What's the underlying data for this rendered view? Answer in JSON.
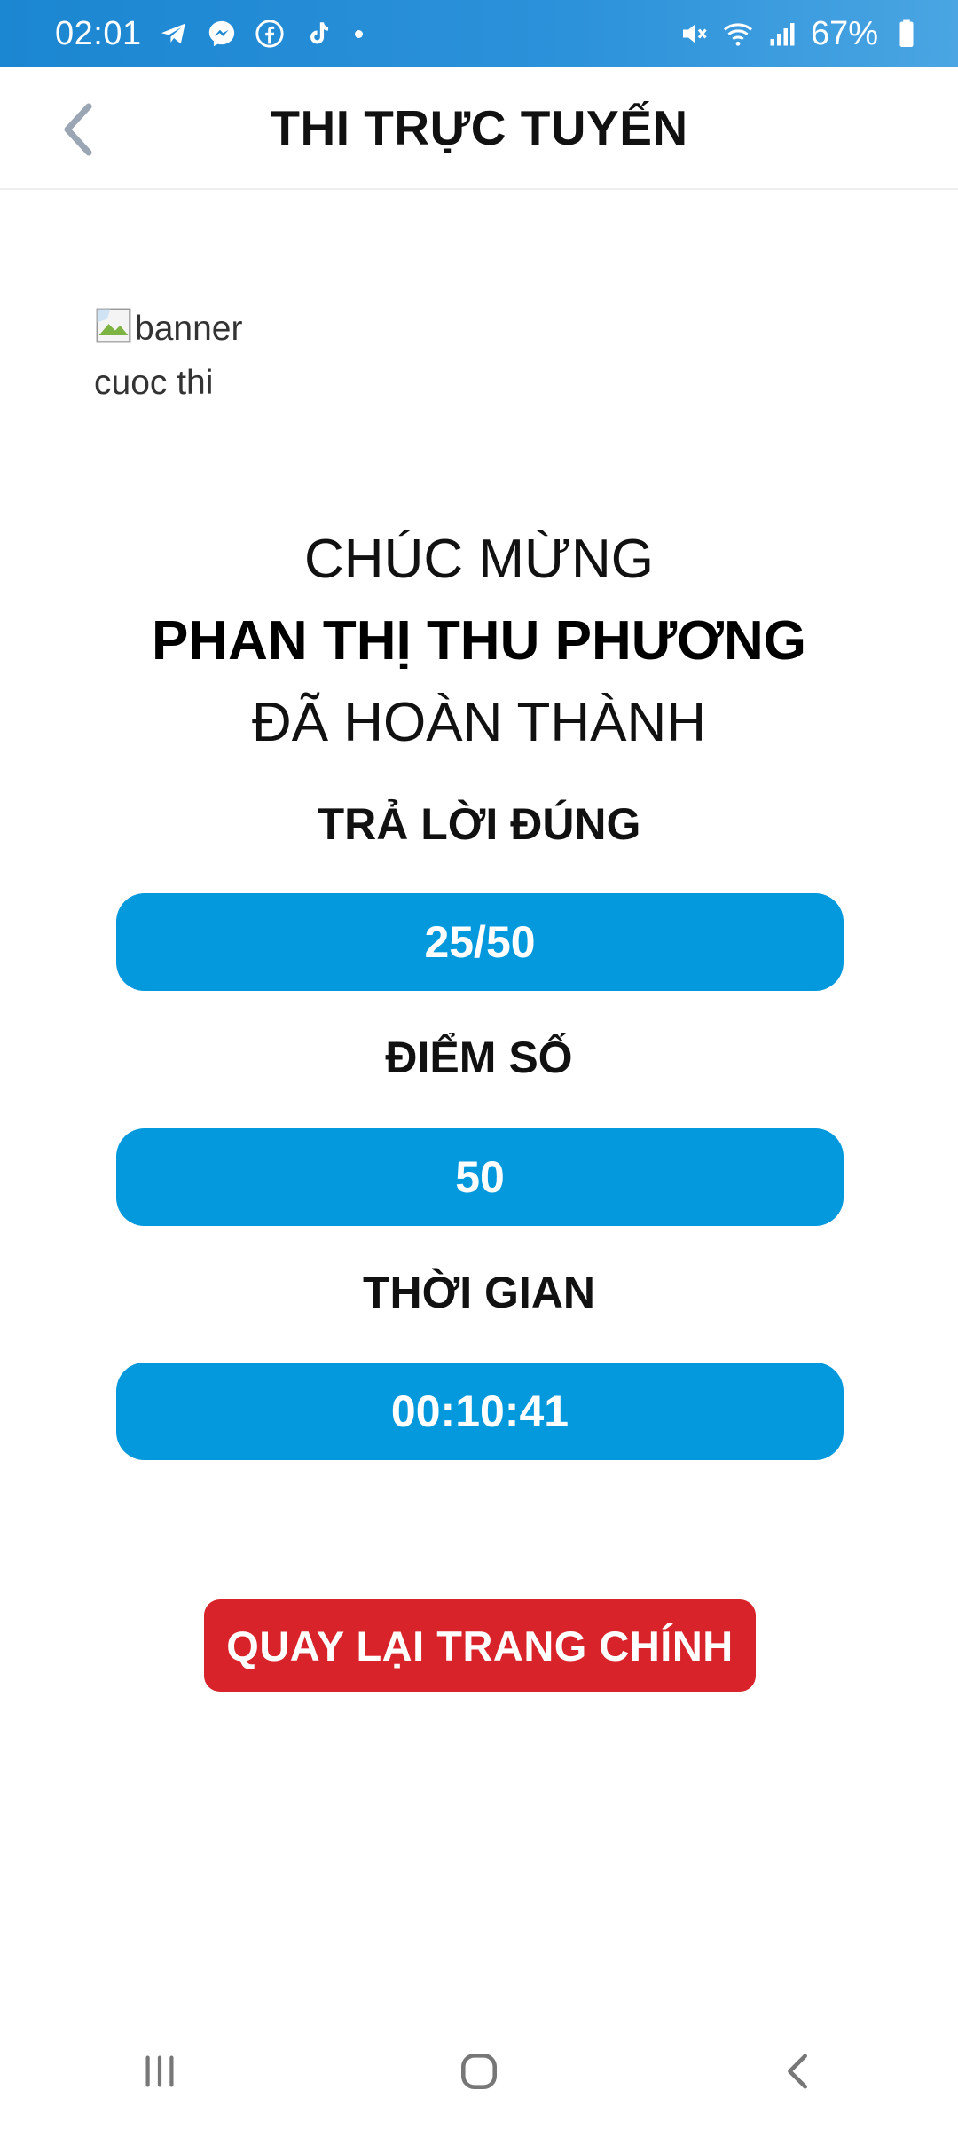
{
  "status_bar": {
    "time": "02:01",
    "notification_icons": [
      "telegram-icon",
      "messenger-icon",
      "facebook-icon",
      "tiktok-icon"
    ],
    "battery": "67%"
  },
  "header": {
    "title": "THI TRỰC TUYẾN",
    "back_icon": "chevron-left-icon"
  },
  "banner": {
    "alt_text": "banner cuoc thi"
  },
  "congrats": {
    "line1": "CHÚC MỪNG",
    "name": "PHAN THỊ THU PHƯƠNG",
    "line3": "ĐÃ HOÀN THÀNH"
  },
  "results": {
    "correct_label": "TRẢ LỜI ĐÚNG",
    "correct_value": "25/50",
    "score_label": "ĐIỂM SỐ",
    "score_value": "50",
    "time_label": "THỜI GIAN",
    "time_value": "00:10:41"
  },
  "actions": {
    "home_button_label": "QUAY LẠI TRANG CHÍNH"
  },
  "colors": {
    "accent_blue": "#0399dc",
    "button_red": "#d9232b",
    "status_bar_blue": "#1b86d1"
  }
}
